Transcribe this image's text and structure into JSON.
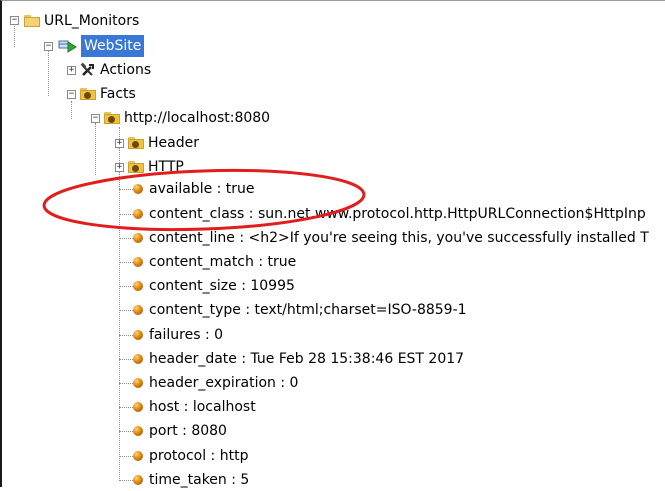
{
  "tree": {
    "root": "URL_Monitors",
    "website": "WebSite",
    "actions": "Actions",
    "facts": "Facts",
    "url": "http://localhost:8080",
    "header": "Header",
    "http": "HTTP",
    "facts_list": [
      "available : true",
      "content_class : sun.net.www.protocol.http.HttpURLConnection$HttpInp",
      "content_line : <h2>If you're seeing this, you've successfully installed T",
      "content_match : true",
      "content_size : 10995",
      "content_type : text/html;charset=ISO-8859-1",
      "failures : 0",
      "header_date : Tue Feb 28 15:38:46 EST 2017",
      "header_expiration : 0",
      "host : localhost",
      "port : 8080",
      "protocol : http",
      "time_taken : 5"
    ]
  },
  "icons": {
    "root": "folder-icon",
    "website": "website-icon",
    "actions": "tools-icon",
    "facts": "folder-icon",
    "fact_item": "ball-icon"
  },
  "colors": {
    "selection": "#3a78d7",
    "annotation": "#e21d1d",
    "fact_ball": "#e08a12"
  }
}
